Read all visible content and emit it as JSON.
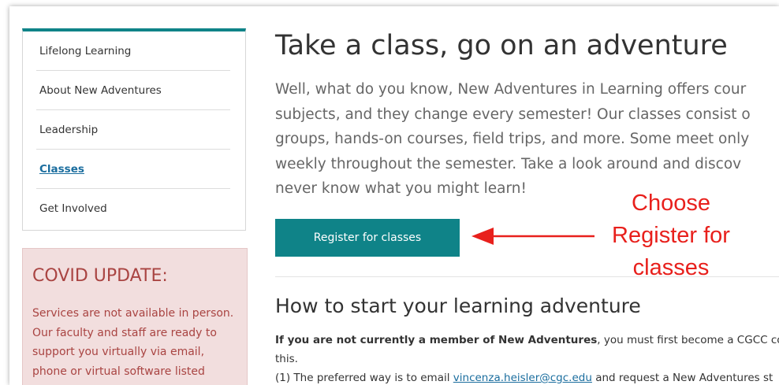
{
  "sidebar": {
    "items": [
      {
        "label": "Lifelong Learning",
        "active": false
      },
      {
        "label": "About New Adventures",
        "active": false
      },
      {
        "label": "Leadership",
        "active": false
      },
      {
        "label": "Classes",
        "active": true
      },
      {
        "label": "Get Involved",
        "active": false
      }
    ],
    "accent_color": "#0f8388"
  },
  "covid": {
    "title": "COVID UPDATE:",
    "lines": [
      "Services are not available in person.",
      "Our faculty and staff are ready to",
      "support you virtually via email,",
      "phone or virtual software listed"
    ],
    "bg_color": "#f2dede",
    "text_color": "#a94442"
  },
  "main": {
    "title": "Take a class, go on an adventure",
    "intro_lines": [
      "Well, what do you know, New Adventures in Learning offers cour",
      "subjects, and they change every semester! Our classes consist o",
      "groups, hands-on courses, field trips, and more. Some meet only",
      "weekly throughout the semester. Take a look around and discov",
      "never know what you might learn!"
    ],
    "register_label": "Register for classes",
    "register_color": "#0f8388",
    "subhead": "How to start your learning adventure",
    "para_bold": "If you are not currently a member of New Adventures",
    "para_rest": ", you must first become a CGCC col",
    "para_line2": "this.",
    "para_line3_pre": "(1) The preferred way is to email ",
    "para_line3_link": "vincenza.heisler@cgc.edu",
    "para_line3_post": " and request a New Adventures st"
  },
  "annotation": {
    "lines": [
      "Choose",
      "Register for",
      "classes"
    ],
    "color": "#e8201c",
    "arrow": "left-arrow"
  }
}
